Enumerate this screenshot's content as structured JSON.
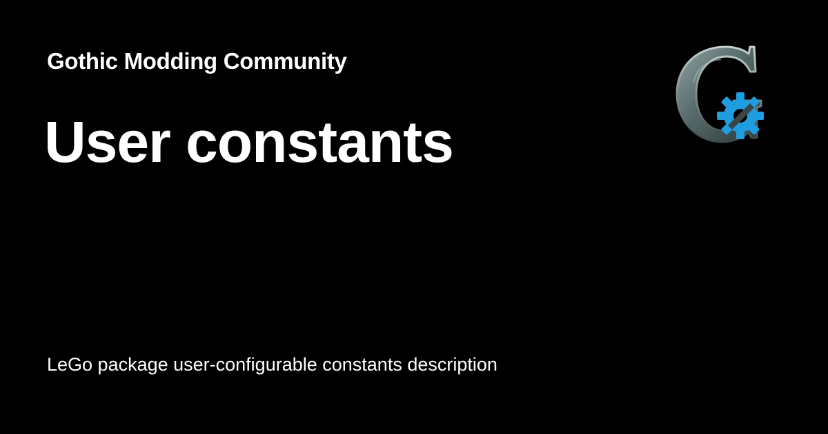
{
  "header": {
    "site_name": "Gothic Modding Community"
  },
  "page": {
    "title": "User constants",
    "description": "LeGo package user-configurable constants description"
  },
  "logo": {
    "icon": "gothic-g-gear-logo",
    "letter_color": "#5b6b6c",
    "gear_color": "#1e9de0"
  },
  "colors": {
    "background": "#000000",
    "text": "#ffffff"
  }
}
